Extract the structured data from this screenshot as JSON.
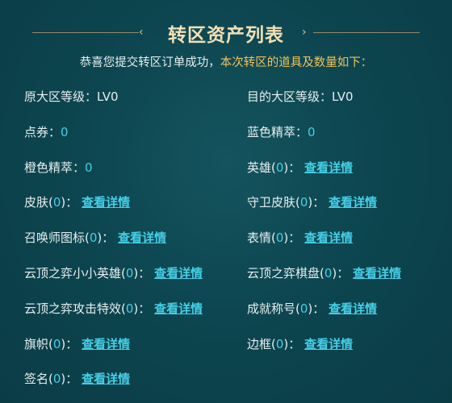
{
  "title": "转区资产列表",
  "subtitle": {
    "prefix": "恭喜您提交转区订单成功，",
    "highlight": "本次转区的道具及数量如下："
  },
  "labels": {
    "detail": "查看详情",
    "colon": "：",
    "open": "(",
    "close": ")"
  },
  "items": {
    "source_level": {
      "label": "原大区等级",
      "value": "LV0"
    },
    "target_level": {
      "label": "目的大区等级",
      "value": "LV0"
    },
    "coupons": {
      "label": "点券",
      "value": "0"
    },
    "blue_essence": {
      "label": "蓝色精萃",
      "value": "0"
    },
    "orange_essence": {
      "label": "橙色精萃",
      "value": "0"
    },
    "heroes": {
      "label": "英雄",
      "count": "0"
    },
    "skins": {
      "label": "皮肤",
      "count": "0"
    },
    "ward_skins": {
      "label": "守卫皮肤",
      "count": "0"
    },
    "summoner_icons": {
      "label": "召唤师图标",
      "count": "0"
    },
    "emotes": {
      "label": "表情",
      "count": "0"
    },
    "tft_little_legends": {
      "label": "云顶之弈小小英雄",
      "count": "0"
    },
    "tft_boards": {
      "label": "云顶之弈棋盘",
      "count": "0"
    },
    "tft_attack_effects": {
      "label": "云顶之弈攻击特效",
      "count": "0"
    },
    "achievement_titles": {
      "label": "成就称号",
      "count": "0"
    },
    "banners": {
      "label": "旗帜",
      "count": "0"
    },
    "borders": {
      "label": "边框",
      "count": "0"
    },
    "signatures": {
      "label": "签名",
      "count": "0"
    }
  }
}
